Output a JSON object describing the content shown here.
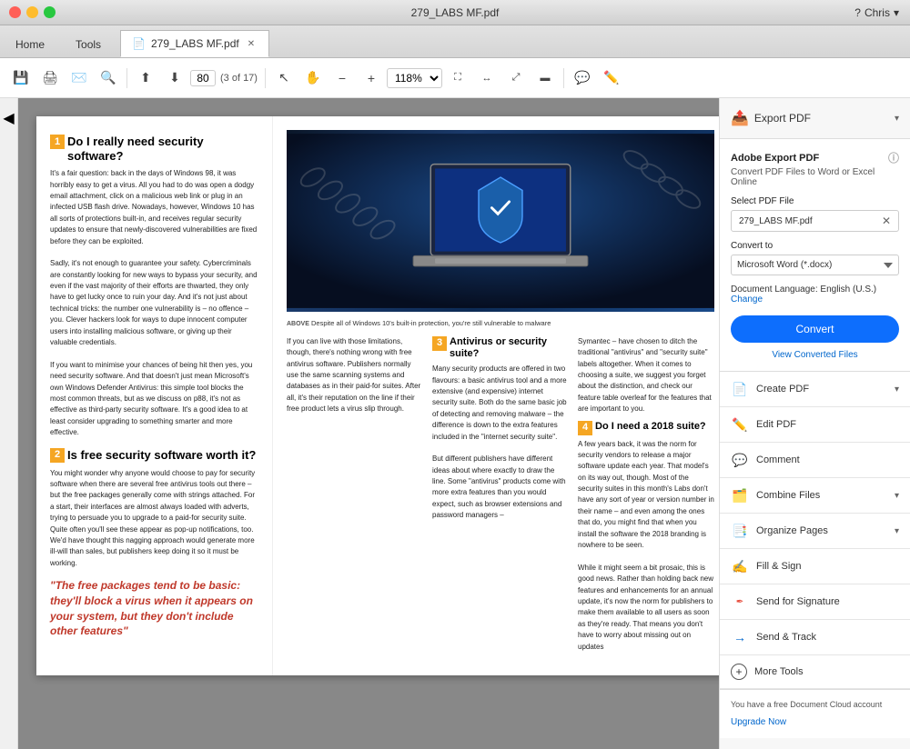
{
  "titlebar": {
    "title": "279_LABS MF.pdf",
    "user": "Chris"
  },
  "tabs": {
    "home": "Home",
    "tools": "Tools",
    "file": "279_LABS MF.pdf"
  },
  "toolbar": {
    "page_current": "80",
    "page_total": "17",
    "zoom": "118%",
    "prev_label": "Previous page",
    "next_label": "Next page"
  },
  "right_panel": {
    "export_pdf": {
      "header": "Export PDF",
      "adobe_title": "Adobe Export PDF",
      "subtitle": "Convert PDF Files to Word or Excel Online",
      "select_file_label": "Select PDF File",
      "file_name": "279_LABS MF.pdf",
      "convert_to_label": "Convert to",
      "convert_to_value": "Microsoft Word (*.docx)",
      "doc_language_label": "Document Language:",
      "doc_language_value": "English (U.S.)",
      "change_label": "Change",
      "convert_btn": "Convert",
      "view_converted": "View Converted Files"
    },
    "tools": [
      {
        "id": "create-pdf",
        "label": "Create PDF",
        "icon": "📄",
        "has_chevron": true
      },
      {
        "id": "edit-pdf",
        "label": "Edit PDF",
        "icon": "✏️",
        "has_chevron": false
      },
      {
        "id": "comment",
        "label": "Comment",
        "icon": "💬",
        "has_chevron": false
      },
      {
        "id": "combine-files",
        "label": "Combine Files",
        "icon": "🗂️",
        "has_chevron": true
      },
      {
        "id": "organize-pages",
        "label": "Organize Pages",
        "icon": "📑",
        "has_chevron": true
      },
      {
        "id": "fill-sign",
        "label": "Fill & Sign",
        "icon": "✍️",
        "has_chevron": false
      },
      {
        "id": "send-signature",
        "label": "Send for Signature",
        "icon": "🖊️",
        "has_chevron": false
      },
      {
        "id": "send-track",
        "label": "Send & Track",
        "icon": "→",
        "has_chevron": false
      },
      {
        "id": "more-tools",
        "label": "More Tools",
        "icon": "+",
        "has_chevron": false
      }
    ],
    "bottom_note": "You have a free Document Cloud account",
    "upgrade_link": "Upgrade Now"
  },
  "article": {
    "section1": {
      "num": "1",
      "title": "Do I really need security software?",
      "body": "It's a fair question: back in the days of Windows 98, it was horribly easy to get a virus. All you had to do was open a dodgy email attachment, click on a malicious web link or plug in an infected USB flash drive. Nowadays, however, Windows 10 has all sorts of protections built-in, and receives regular security updates to ensure that newly-discovered vulnerabilities are fixed before they can be exploited.\n\nSadly, it's not enough to guarantee your safety. Cybercriminals are constantly looking for new ways to bypass your security, and even if the vast majority of their efforts are thwarted, they only have to get lucky once to ruin your day. And it's not just about technical tricks: the number one vulnerability is – no offence – you. Clever hackers look for ways to dupe innocent computer users into installing malicious software, or giving up their valuable credentials.\n\nIf you want to minimise your chances of being hit then yes, you need security software. And that doesn't just mean Microsoft's own Windows Defender Antivirus: this simple tool blocks the most common threats, but as we discuss on p88, it's not as effective as third-party security software. It's a good idea to at least consider upgrading to something smarter and more effective."
    },
    "section2": {
      "num": "2",
      "title": "Is free security software worth it?",
      "body": "You might wonder why anyone would choose to pay for security software when there are several free antivirus tools out there – but the free packages generally come with strings attached. For a start, their interfaces are almost always loaded with adverts, trying to persuade you to upgrade to a paid-for security suite. Quite often you'll see these appear as pop-up notifications, too. We'd have thought this nagging approach would generate more ill-will than sales, but publishers keep doing it so it must be working."
    },
    "caption": {
      "above_label": "ABOVE",
      "caption_text": "Despite all of Windows 10's built-in protection, you're still vulnerable to malware"
    },
    "col_text1": "If you can live with those limitations, though, there's nothing wrong with free antivirus software. Publishers normally use the same scanning systems and databases as in their paid-for suites. After all, it's their reputation on the line if their free product lets a virus slip through.",
    "col_text2_intro": "Symantec – have chosen to ditch the traditional \"antivirus\" and \"security suite\" labels altogether. When it comes to choosing a suite, we suggest you forget about the distinction, and check our feature table overleaf for the features that are important to you.",
    "section3": {
      "num": "3",
      "title": "Antivirus or security suite?",
      "body": "Many security products are offered in two flavours: a basic antivirus tool and a more extensive (and expensive) internet security suite. Both do the same basic job of detecting and removing malware – the difference is down to the extra features included in the \"internet security suite\".\n\nBut different publishers have different ideas about where exactly to draw the line. Some \"antivirus\" products come with more extra features than you would expect, such as browser extensions and password managers –"
    },
    "section4": {
      "num": "4",
      "title": "Do I need a 2018 suite?",
      "body": "A few years back, it was the norm for security vendors to release a major software update each year. That model's on its way out, though. Most of the security suites in this month's Labs don't have any sort of year or version number in their name – and even among the ones that do, you might find that when you install the software the 2018 branding is nowhere to be seen.\n\nWhile it might seem a bit prosaic, this is good news. Rather than holding back new features and enhancements for an annual update, it's now the norm for publishers to make them available to all users as soon as they're ready. That means you don't have to worry about missing out on updates"
    },
    "pullquote": "\"The free packages tend to be basic: they'll block a virus when it appears on your system, but they don't include other features\""
  }
}
